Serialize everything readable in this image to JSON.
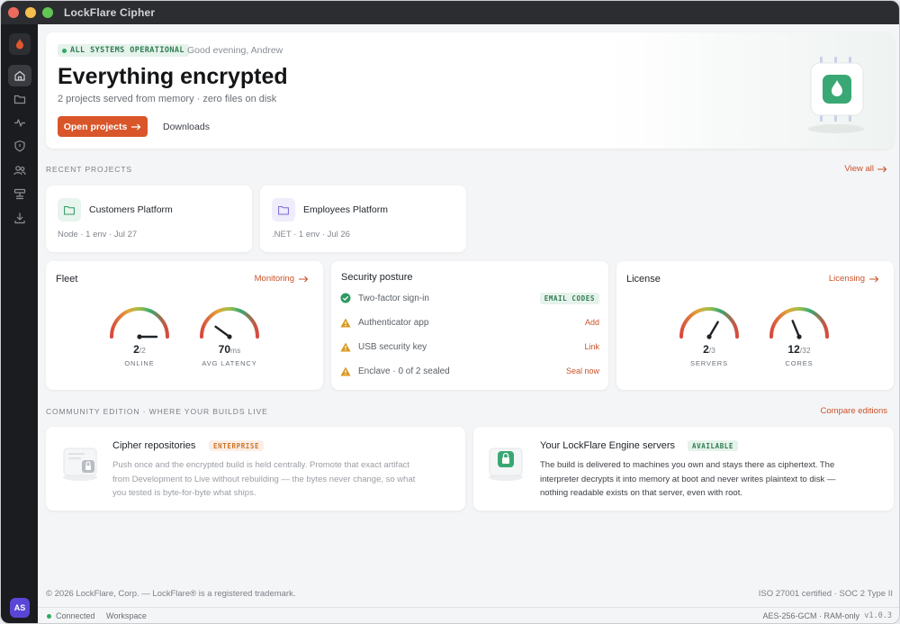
{
  "window": {
    "title": "LockFlare Cipher"
  },
  "sidebar": {
    "items": [
      {
        "icon": "home-icon"
      },
      {
        "icon": "folder-icon"
      },
      {
        "icon": "activity-icon"
      },
      {
        "icon": "shield-icon"
      },
      {
        "icon": "users-icon"
      },
      {
        "icon": "server-icon"
      },
      {
        "icon": "download-icon"
      }
    ],
    "avatar_initials": "AS"
  },
  "hero": {
    "status": "ALL SYSTEMS OPERATIONAL",
    "greeting": "Good evening, Andrew",
    "title": "Everything encrypted",
    "subtitle": "2 projects served from memory · zero files on disk",
    "primary_button": "Open projects",
    "secondary_button": "Downloads"
  },
  "recent": {
    "label": "RECENT PROJECTS",
    "view_all": "View all",
    "projects": [
      {
        "name": "Customers Platform",
        "meta": "Node · 1 env · Jul 27",
        "accent": "#2e9a63"
      },
      {
        "name": "Employees Platform",
        "meta": ".NET · 1 env · Jul 26",
        "accent": "#7a66d8"
      }
    ]
  },
  "fleet": {
    "title": "Fleet",
    "link": "Monitoring",
    "gauges": [
      {
        "value": "2",
        "unit": "/2",
        "label": "ONLINE",
        "fraction": 1.0
      },
      {
        "value": "70",
        "unit": "ms",
        "label": "AVG LATENCY",
        "fraction": 0.2
      }
    ]
  },
  "security": {
    "title": "Security posture",
    "rows": [
      {
        "label": "Two-factor sign-in",
        "status": "ok",
        "tag": "EMAIL CODES",
        "action": ""
      },
      {
        "label": "Authenticator app",
        "status": "warn",
        "tag": "",
        "action": "Add"
      },
      {
        "label": "USB security key",
        "status": "warn",
        "tag": "",
        "action": "Link"
      },
      {
        "label": "Enclave · 0 of 2 sealed",
        "status": "warn",
        "tag": "",
        "action": "Seal now"
      }
    ]
  },
  "license": {
    "title": "License",
    "link": "Licensing",
    "gauges": [
      {
        "value": "2",
        "unit": "/3",
        "label": "SERVERS",
        "fraction": 0.67
      },
      {
        "value": "12",
        "unit": "/32",
        "label": "CORES",
        "fraction": 0.375
      }
    ]
  },
  "community": {
    "label": "COMMUNITY EDITION · WHERE YOUR BUILDS LIVE",
    "compare": "Compare editions",
    "features": [
      {
        "title": "Cipher repositories",
        "badge": "ENTERPRISE",
        "body": [
          "Push once and the encrypted build is held centrally. Promote that exact artifact",
          "from Development to Live without rebuilding — the bytes never change, so what",
          "you tested is byte-for-byte what ships."
        ]
      },
      {
        "title": "Your LockFlare Engine servers",
        "badge": "AVAILABLE",
        "body": [
          "The build is delivered to machines you own and stays there as ciphertext. The",
          "interpreter decrypts it into memory at boot and never writes plaintext to disk —",
          "nothing readable exists on that server, even with root."
        ]
      }
    ]
  },
  "footer": {
    "copyright": "© 2026 LockFlare, Corp. — LockFlare® is a registered trademark.",
    "certs": "ISO 27001 certified · SOC 2 Type II"
  },
  "statusbar": {
    "connection": "Connected",
    "workspace": "Workspace",
    "crypto": "AES-256-GCM · RAM-only",
    "version": "v1.0.3"
  },
  "colors": {
    "accent": "#d8562a",
    "success": "#2faa62",
    "warning": "#d99a1e",
    "sidebar": "#1b1c1f"
  }
}
